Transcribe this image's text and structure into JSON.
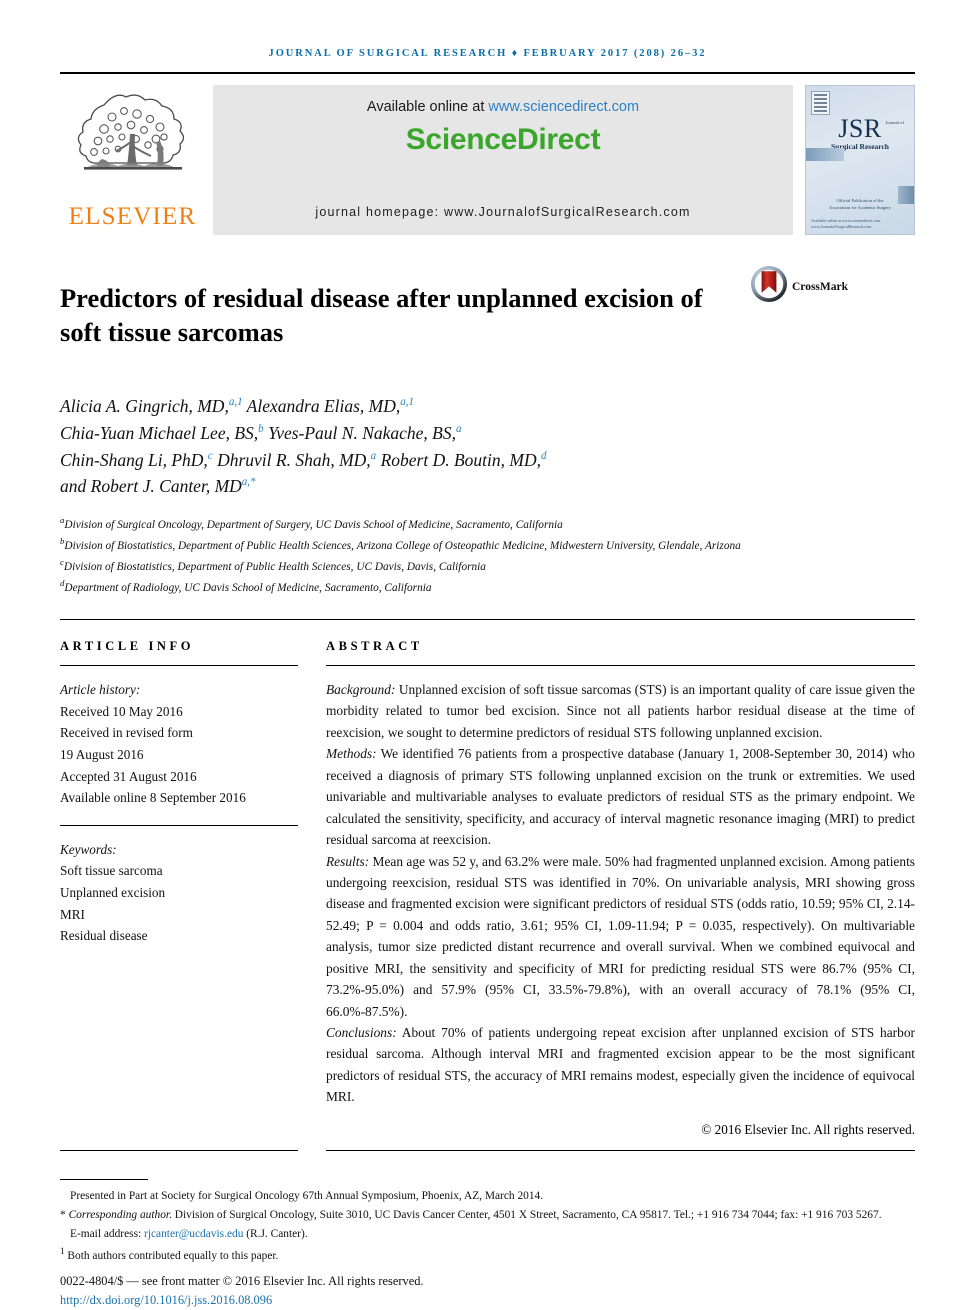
{
  "running_head": "Journal of Surgical Research ♦ February 2017 (208) 26–32",
  "masthead": {
    "publisher_name": "ELSEVIER",
    "publisher_logo_icon": "elsevier-tree-icon",
    "available_prefix": "Available online at ",
    "available_url": "www.sciencedirect.com",
    "sciencedirect_logo": "ScienceDirect",
    "journal_homepage": "journal homepage: www.JournalofSurgicalResearch.com",
    "cover": {
      "acronym": "JSR",
      "journal_of": "Journal of",
      "journal_name": "Surgical Research",
      "note_line1": "Official Publication of the",
      "note_line2": "Association for Academic Surgery",
      "foot_line1": "Available online at www.sciencedirect.com",
      "foot_line2": "www.JournalofSurgicalResearch.com"
    }
  },
  "article": {
    "title": "Predictors of residual disease after unplanned excision of soft tissue sarcomas",
    "crossmark_label": "CrossMark",
    "authors_html": "Alicia A. Gingrich, MD,<sup>a,1</sup> Alexandra Elias, MD,<sup>a,1</sup><br>Chia-Yuan Michael Lee, BS,<sup>b</sup> Yves-Paul N. Nakache, BS,<sup>a</sup><br>Chin-Shang Li, PhD,<sup>c</sup> Dhruvil R. Shah, MD,<sup>a</sup> Robert D. Boutin, MD,<sup>d</sup><br>and Robert J. Canter, MD<sup>a,*</sup>",
    "affiliations": [
      {
        "marker": "a",
        "text": "Division of Surgical Oncology, Department of Surgery, UC Davis School of Medicine, Sacramento, California"
      },
      {
        "marker": "b",
        "text": "Division of Biostatistics, Department of Public Health Sciences, Arizona College of Osteopathic Medicine, Midwestern University, Glendale, Arizona"
      },
      {
        "marker": "c",
        "text": "Division of Biostatistics, Department of Public Health Sciences, UC Davis, Davis, California"
      },
      {
        "marker": "d",
        "text": "Department of Radiology, UC Davis School of Medicine, Sacramento, California"
      }
    ]
  },
  "article_info": {
    "heading": "ARTICLE INFO",
    "history_label": "Article history:",
    "history": [
      "Received 10 May 2016",
      "Received in revised form",
      "19 August 2016",
      "Accepted 31 August 2016",
      "Available online 8 September 2016"
    ],
    "keywords_label": "Keywords:",
    "keywords": [
      "Soft tissue sarcoma",
      "Unplanned excision",
      "MRI",
      "Residual disease"
    ]
  },
  "abstract": {
    "heading": "ABSTRACT",
    "sections": [
      {
        "label": "Background:",
        "text": " Unplanned excision of soft tissue sarcomas (STS) is an important quality of care issue given the morbidity related to tumor bed excision. Since not all patients harbor residual disease at the time of reexcision, we sought to determine predictors of residual STS following unplanned excision."
      },
      {
        "label": "Methods:",
        "text": " We identified 76 patients from a prospective database (January 1, 2008-September 30, 2014) who received a diagnosis of primary STS following unplanned excision on the trunk or extremities. We used univariable and multivariable analyses to evaluate predictors of residual STS as the primary endpoint. We calculated the sensitivity, specificity, and accuracy of interval magnetic resonance imaging (MRI) to predict residual sarcoma at reexcision."
      },
      {
        "label": "Results:",
        "text": " Mean age was 52 y, and 63.2% were male. 50% had fragmented unplanned excision. Among patients undergoing reexcision, residual STS was identified in 70%. On univariable analysis, MRI showing gross disease and fragmented excision were significant predictors of residual STS (odds ratio, 10.59; 95% CI, 2.14-52.49; P = 0.004 and odds ratio, 3.61; 95% CI, 1.09-11.94; P = 0.035, respectively). On multivariable analysis, tumor size predicted distant recurrence and overall survival. When we combined equivocal and positive MRI, the sensitivity and specificity of MRI for predicting residual STS were 86.7% (95% CI, 73.2%-95.0%) and 57.9% (95% CI, 33.5%-79.8%), with an overall accuracy of 78.1% (95% CI, 66.0%-87.5%)."
      },
      {
        "label": "Conclusions:",
        "text": " About 70% of patients undergoing repeat excision after unplanned excision of STS harbor residual sarcoma. Although interval MRI and fragmented excision appear to be the most significant predictors of residual STS, the accuracy of MRI remains modest, especially given the incidence of equivocal MRI."
      }
    ],
    "copyright": "© 2016 Elsevier Inc. All rights reserved."
  },
  "footnotes": {
    "presented": "Presented in Part at Society for Surgical Oncology 67th Annual Symposium, Phoenix, AZ, March 2014.",
    "corresponding_marker": "*",
    "corresponding_italic": "Corresponding author.",
    "corresponding_text": " Division of Surgical Oncology, Suite 3010, UC Davis Cancer Center, 4501 X Street, Sacramento, CA 95817. Tel.; +1 916 734 7044; fax: +1 916 703 5267.",
    "email_label": "E-mail address: ",
    "email_address": "rjcanter@ucdavis.edu",
    "email_suffix": " (R.J. Canter).",
    "equal_marker": "1",
    "equal_contrib": " Both authors contributed equally to this paper.",
    "front_matter": "0022-4804/$ — see front matter © 2016 Elsevier Inc. All rights reserved.",
    "doi": "http://dx.doi.org/10.1016/j.jss.2016.08.096"
  },
  "colors": {
    "link_blue": "#1a72ad",
    "runhead_blue": "#0b6ea8",
    "elsevier_orange": "#f07f13",
    "sciencedirect_green": "#3aa62b",
    "sd_link_blue": "#2b7fc4"
  }
}
